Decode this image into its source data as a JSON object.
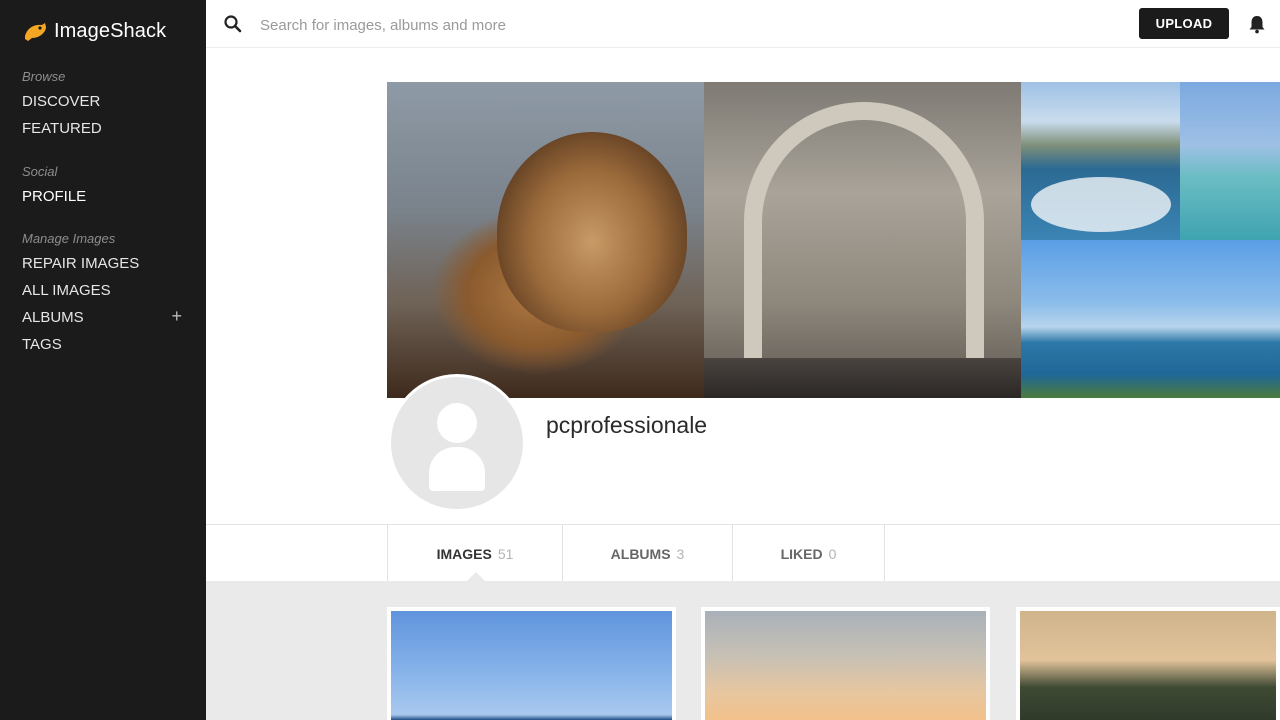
{
  "app": {
    "name": "ImageShack"
  },
  "sidebar": {
    "sections": [
      {
        "heading": "Browse",
        "items": [
          {
            "label": "DISCOVER"
          },
          {
            "label": "FEATURED"
          }
        ]
      },
      {
        "heading": "Social",
        "items": [
          {
            "label": "PROFILE",
            "active": true
          }
        ]
      },
      {
        "heading": "Manage Images",
        "items": [
          {
            "label": "REPAIR IMAGES"
          },
          {
            "label": "ALL IMAGES"
          },
          {
            "label": "ALBUMS",
            "action": "+"
          },
          {
            "label": "TAGS"
          }
        ]
      }
    ]
  },
  "topbar": {
    "search_placeholder": "Search for images, albums and more",
    "upload_label": "UPLOAD"
  },
  "profile": {
    "username": "pcprofessionale"
  },
  "tabs": [
    {
      "label": "IMAGES",
      "count": "51",
      "active": true
    },
    {
      "label": "ALBUMS",
      "count": "3"
    },
    {
      "label": "LIKED",
      "count": "0"
    }
  ],
  "colors": {
    "sidebar_bg": "#1b1b1b",
    "logo_accent": "#f5a623",
    "grid_bg": "#eaeaea"
  },
  "icons": [
    "logo-frog-icon",
    "search-icon",
    "bell-icon",
    "plus-icon"
  ]
}
